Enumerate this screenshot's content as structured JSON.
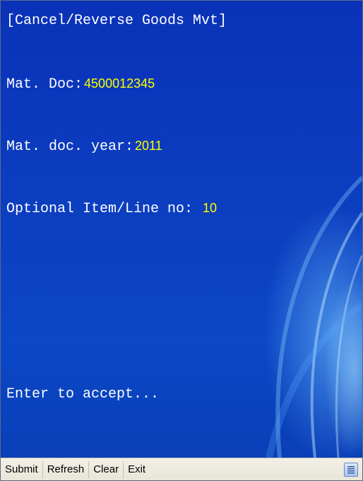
{
  "screen": {
    "title": "[Cancel/Reverse Goods Mvt]",
    "mat_doc": {
      "label": "Mat. Doc:",
      "value": "4500012345"
    },
    "mat_doc_year": {
      "label": "Mat. doc. year:",
      "value": "2011"
    },
    "item_line": {
      "label": "Optional Item/Line no:",
      "value": "10"
    },
    "prompt": "Enter to accept..."
  },
  "toolbar": {
    "submit_label": "Submit",
    "refresh_label": "Refresh",
    "clear_label": "Clear",
    "exit_label": "Exit",
    "keyboard_icon": "keyboard-icon"
  },
  "colors": {
    "background": "#0c3ec0",
    "label_text": "#ffffff",
    "value_text": "#ffff00",
    "toolbar_bg": "#ece9dc"
  }
}
